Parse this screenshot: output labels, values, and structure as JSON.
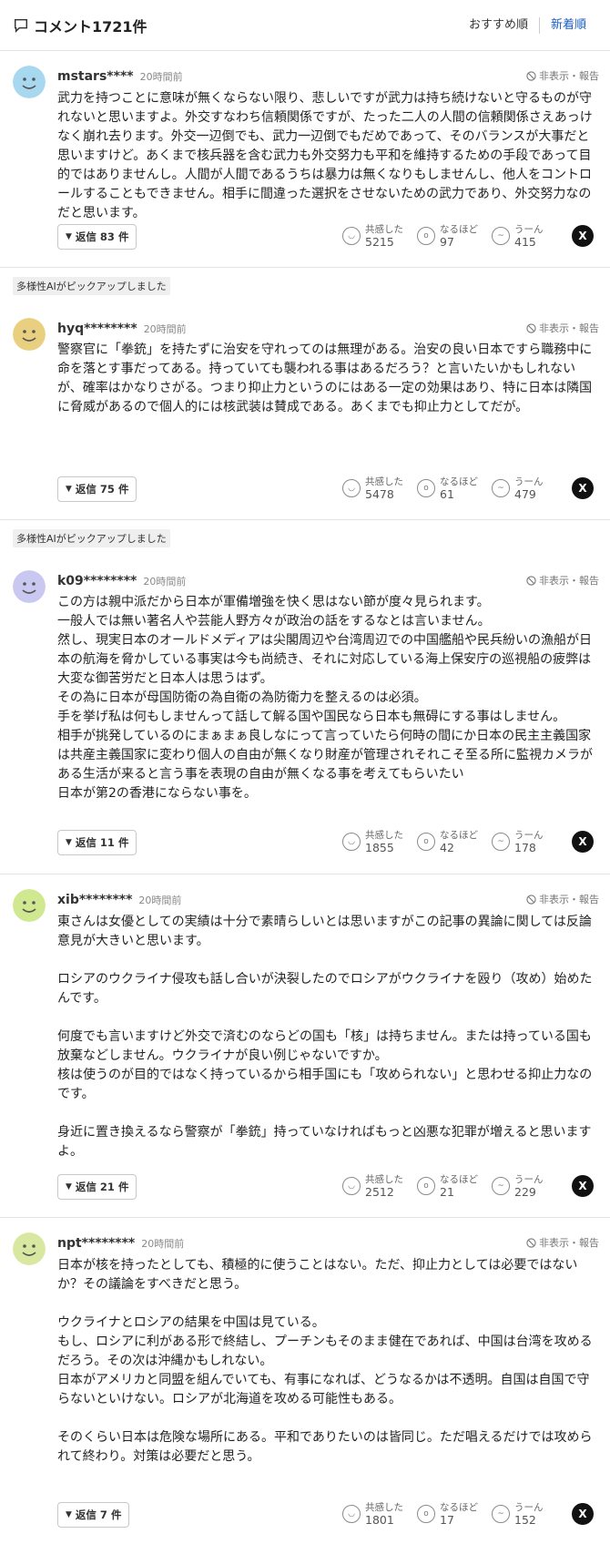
{
  "header": {
    "title": "コメント1721件",
    "sort_recommended": "おすすめ順",
    "sort_newest": "新着順"
  },
  "ui": {
    "hide_report": "非表示・報告",
    "reply_prefix": "返信",
    "reply_suffix": "件",
    "react_agree": "共感した",
    "react_insight": "なるほど",
    "react_hmm": "うーん",
    "x_label": "X",
    "ai_pick": "多様性AIがピックアップしました"
  },
  "comments": [
    {
      "user": "mstars****",
      "time": "20時間前",
      "avatar_color": "#a8d8f0",
      "body": "武力を持つことに意味が無くならない限り、悲しいですが武力は持ち続けないと守るものが守れないと思いますよ。外交すなわち信頼関係ですが、たった二人の人間の信頼関係さえあっけなく崩れ去ります。外交一辺倒でも、武力一辺倒でもだめであって、そのバランスが大事だと思いますけど。あくまで核兵器を含む武力も外交努力も平和を維持するための手段であって目的ではありませんし。人間が人間であるうちは暴力は無くなりもしませんし、他人をコントロールすることもできません。相手に間違った選択をさせないための武力であり、外交努力なのだと思います。",
      "replies": "83",
      "agree": "5215",
      "insight": "97",
      "hmm": "415"
    },
    {
      "user": "hyq********",
      "time": "20時間前",
      "avatar_color": "#e8d080",
      "body": "警察官に「拳銃」を持たずに治安を守れってのは無理がある。治安の良い日本ですら職務中に命を落とす事だってある。持っていても襲われる事はあるだろう？と言いたいかもしれないが、確率はかなりさがる。つまり抑止力というのにはある一定の効果はあり、特に日本は隣国に脅威があるので個人的には核武装は賛成である。あくまでも抑止力としてだが。",
      "replies": "75",
      "agree": "5478",
      "insight": "61",
      "hmm": "479"
    },
    {
      "user": "k09********",
      "time": "20時間前",
      "avatar_color": "#c8c8f0",
      "body": "この方は親中派だから日本が軍備増強を快く思はない節が度々見られます。\n一般人では無い著名人や芸能人野方々が政治の話をするなとは言いません。\n然し、現実日本のオールドメディアは尖閣周辺や台湾周辺での中国艦船や民兵紛いの漁船が日本の航海を脅かしている事実は今も尚続き、それに対応している海上保安庁の巡視船の疲弊は大変な御苦労だと日本人は思うはず。\nその為に日本が母国防衛の為自衛の為防衛力を整えるのは必須。\n手を挙げ私は何もしませんって話して解る国や国民なら日本も無碍にする事はしません。\n相手が挑発しているのにまぁまぁ良しなにって言っていたら何時の間にか日本の民主主義国家は共産主義国家に変わり個人の自由が無くなり財産が管理されそれこそ至る所に監視カメラがある生活が来ると言う事を表現の自由が無くなる事を考えてもらいたい\n日本が第2の香港にならない事を。",
      "replies": "11",
      "agree": "1855",
      "insight": "42",
      "hmm": "178"
    },
    {
      "user": "xib********",
      "time": "20時間前",
      "avatar_color": "#d0e890",
      "body": "東さんは女優としての実績は十分で素晴らしいとは思いますがこの記事の異論に関しては反論意見が大きいと思います。\n\nロシアのウクライナ侵攻も話し合いが決裂したのでロシアがウクライナを殴り（攻め）始めたんです。\n\n何度でも言いますけど外交で済むのならどの国も「核」は持ちません。または持っている国も放棄などしません。ウクライナが良い例じゃないですか。\n核は使うのが目的ではなく持っているから相手国にも「攻められない」と思わせる抑止力なのです。\n\n身近に置き換えるなら警察が「拳銃」持っていなければもっと凶悪な犯罪が増えると思いますよ。",
      "replies": "21",
      "agree": "2512",
      "insight": "21",
      "hmm": "229"
    },
    {
      "user": "npt********",
      "time": "20時間前",
      "avatar_color": "#d8e8a0",
      "body": "日本が核を持ったとしても、積極的に使うことはない。ただ、抑止力としては必要ではないか？その議論をすべきだと思う。\n\nウクライナとロシアの結果を中国は見ている。\nもし、ロシアに利がある形で終結し、プーチンもそのまま健在であれば、中国は台湾を攻めるだろう。その次は沖縄かもしれない。\n日本がアメリカと同盟を組んでいても、有事になれば、どうなるかは不透明。自国は自国で守らないといけない。ロシアが北海道を攻める可能性もある。\n\nそのくらい日本は危険な場所にある。平和でありたいのは皆同じ。ただ唱えるだけでは攻められて終わり。対策は必要だと思う。",
      "replies": "7",
      "agree": "1801",
      "insight": "17",
      "hmm": "152"
    }
  ]
}
